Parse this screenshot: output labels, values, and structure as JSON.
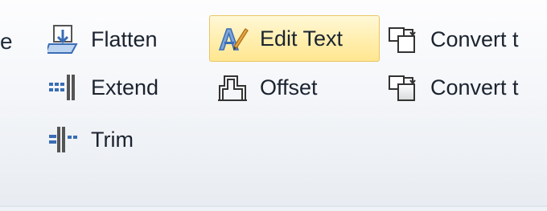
{
  "ribbon": {
    "cut_left_text": "e",
    "buttons": {
      "flatten": {
        "label": "Flatten",
        "icon": "flatten-icon"
      },
      "extend": {
        "label": "Extend",
        "icon": "extend-icon"
      },
      "trim": {
        "label": "Trim",
        "icon": "trim-icon"
      },
      "edit_text": {
        "label": "Edit Text",
        "icon": "edit-text-icon"
      },
      "offset": {
        "label": "Offset",
        "icon": "offset-icon"
      },
      "convert_1": {
        "label": "Convert t",
        "icon": "convert-icon"
      },
      "convert_2": {
        "label": "Convert t",
        "icon": "convert-icon"
      }
    }
  },
  "colors": {
    "highlight_fill": "#ffefb0",
    "highlight_border": "#e8c665",
    "icon_blue": "#3a6db5",
    "label_text": "#1b2330"
  }
}
